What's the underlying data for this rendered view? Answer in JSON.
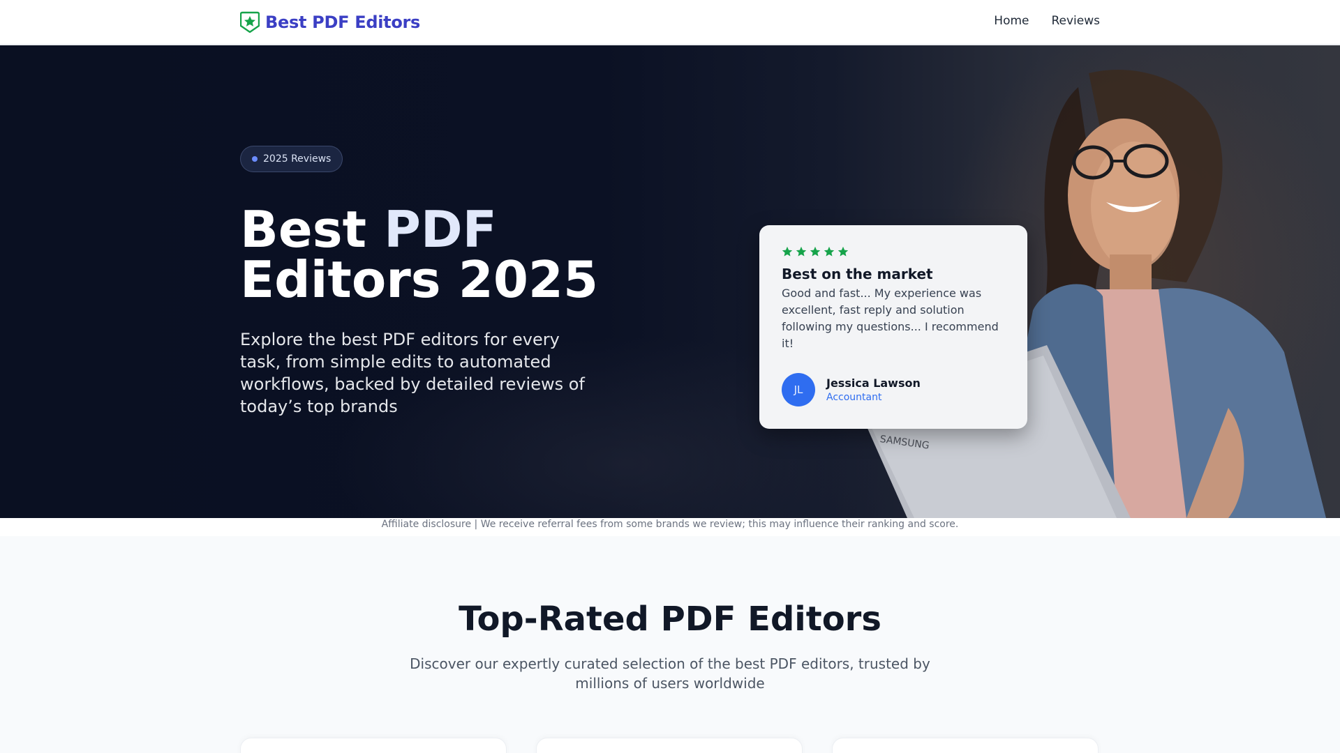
{
  "header": {
    "brand": "Best PDF Editors",
    "nav": [
      {
        "label": "Home"
      },
      {
        "label": "Reviews"
      }
    ]
  },
  "hero": {
    "badge": "2025 Reviews",
    "title_part1": "Best ",
    "title_accent": "PDF",
    "title_part2": "Editors 2025",
    "subtitle": "Explore the best PDF editors for every task, from simple edits to automated workflows, backed by detailed reviews of today’s top brands"
  },
  "review": {
    "rating": 5,
    "title": "Best on the market",
    "body": "Good and fast... My experience was excellent, fast reply and solution following my questions... I recommend it!",
    "initials": "JL",
    "name": "Jessica Lawson",
    "role": "Accountant"
  },
  "disclosure": "Affiliate disclosure | We receive referral fees from some brands we review; this may influence their ranking and score.",
  "section": {
    "title": "Top-Rated PDF Editors",
    "subtitle": "Discover our expertly curated selection of the best PDF editors, trusted by millions of users worldwide"
  },
  "colors": {
    "brand": "#3b3fc4",
    "star": "#16a34a",
    "accent_blue": "#2f6df0",
    "hero_bg": "#0b1124"
  },
  "icons": {
    "brand": "star-shield-icon",
    "rating": "star-icon",
    "badge": "dot-icon"
  }
}
